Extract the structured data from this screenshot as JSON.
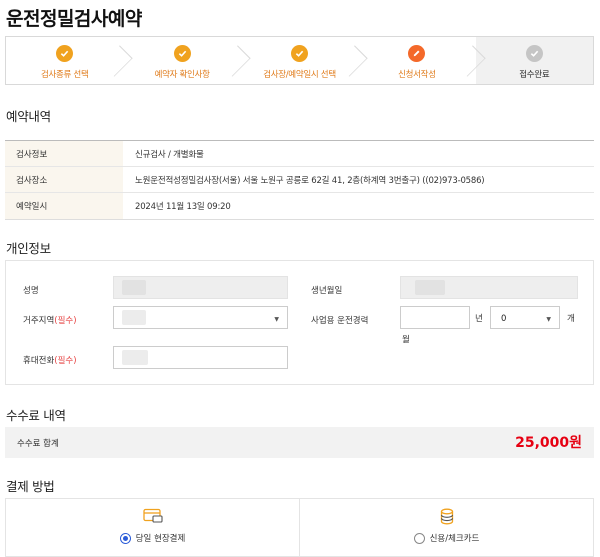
{
  "page": {
    "title": "운전정밀검사예약"
  },
  "steps": [
    {
      "label": "검사종류 선택",
      "state": "done"
    },
    {
      "label": "예약자 확인사항",
      "state": "done"
    },
    {
      "label": "검사장/예약일시 선택",
      "state": "done"
    },
    {
      "label": "신청서작성",
      "state": "current"
    },
    {
      "label": "접수완료",
      "state": "pending"
    }
  ],
  "reservation": {
    "title": "예약내역",
    "rows": [
      {
        "label": "검사정보",
        "value": "신규검사 / 개별화물"
      },
      {
        "label": "검사장소",
        "value": "노원운전적성정밀검사장(서울) 서울 노원구 공릉로 62길 41, 2층(하계역 3번출구) ((02)973-0586)"
      },
      {
        "label": "예약일시",
        "value": "2024년 11월 13일 09:20"
      }
    ]
  },
  "personal": {
    "title": "개인정보",
    "name_label": "성명",
    "birth_label": "생년월일",
    "region_label": "거주지역",
    "required_text": "(필수)",
    "experience_label": "사업용 운전경력",
    "year_unit": "년",
    "month_value": "0",
    "month_unit": "개",
    "month_unit_wrap": "월",
    "phone_label": "휴대전화"
  },
  "fee": {
    "title": "수수료 내역",
    "total_label": "수수료 합계",
    "total_value": "25,000원"
  },
  "payment": {
    "title": "결제 방법",
    "options": [
      {
        "label": "당일 현장결제",
        "icon": "card-reader-icon",
        "selected": true
      },
      {
        "label": "신용/체크카드",
        "icon": "coin-stack-icon",
        "selected": false
      }
    ]
  },
  "colors": {
    "step_done": "#f0a21f",
    "step_current": "#f4692a",
    "step_pending": "#c5c5c5",
    "required": "#e64343",
    "fee_total": "#e60012",
    "radio_selected": "#2b5cd8"
  }
}
